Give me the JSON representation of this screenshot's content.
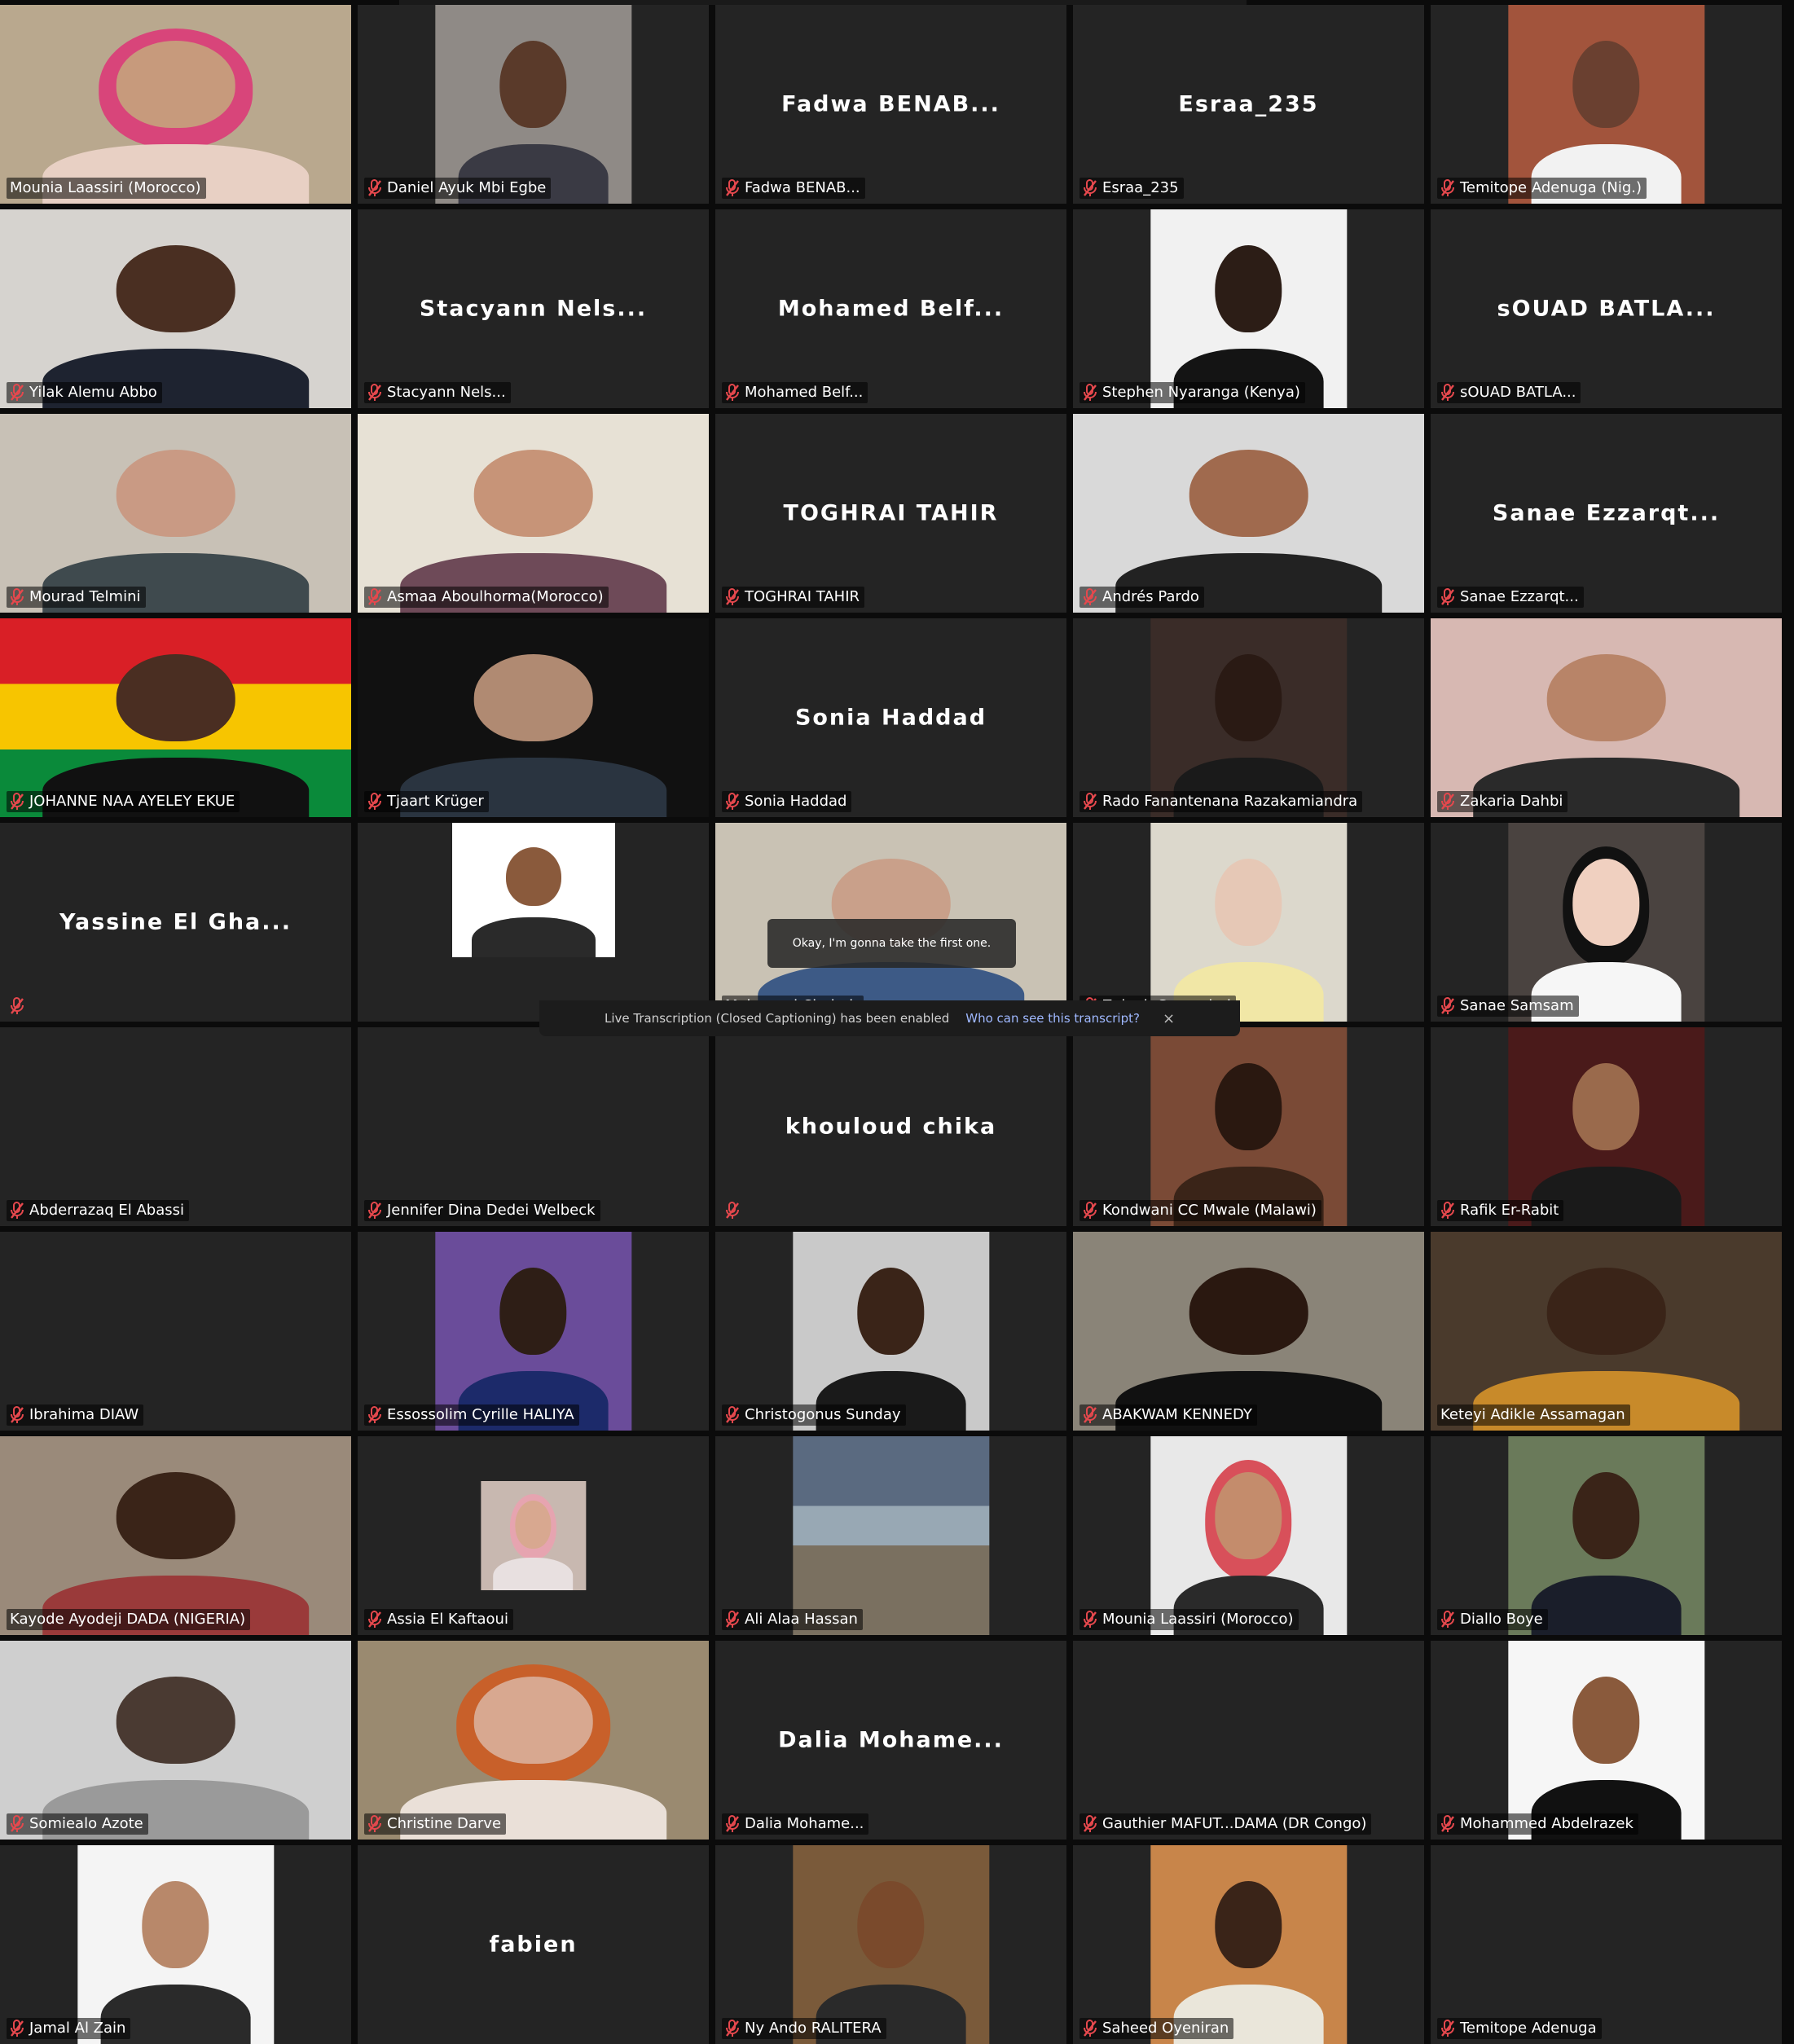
{
  "caption": "Okay, I'm gonna take the first one.",
  "notice": {
    "text": "Live Transcription (Closed Captioning) has been enabled",
    "link": "Who can see this transcript?",
    "close": "×"
  },
  "colors": {
    "tile": "#242424",
    "active_border": "#2bd46a",
    "muted_mic": "#e5484d",
    "background": "#0b0b0b"
  },
  "participants": [
    {
      "name": "Mounia Laassiri (Morocco)",
      "muted": false,
      "video": true,
      "bg": "#b9a88e",
      "skin": "#c79a7c",
      "shirt": "#e8d0c4",
      "hair": "#d8457a"
    },
    {
      "name": "Daniel Ayuk Mbi Egbe",
      "muted": true,
      "video": true,
      "narrow": true,
      "bg": "#8f8a86",
      "skin": "#5a3a2a",
      "shirt": "#3a3a44"
    },
    {
      "name": "Fadwa BENAB...",
      "muted": true,
      "video": false,
      "title": "Fadwa BENAB..."
    },
    {
      "name": "Esraa_235",
      "muted": true,
      "video": false,
      "title": "Esraa_235"
    },
    {
      "name": "Temitope Adenuga (Nig.)",
      "muted": true,
      "video": true,
      "narrow": true,
      "bg": "#a2543c",
      "skin": "#6a4030",
      "shirt": "#f2f2f2"
    },
    {
      "name": "Yilak Alemu Abbo",
      "muted": true,
      "video": true,
      "bg": "#d6d3cf",
      "skin": "#4a2f22",
      "shirt": "#1e2330"
    },
    {
      "name": "Stacyann Nels...",
      "muted": true,
      "video": false,
      "title": "Stacyann Nels..."
    },
    {
      "name": "Mohamed Belf...",
      "muted": true,
      "video": false,
      "title": "Mohamed Belf..."
    },
    {
      "name": "Stephen Nyaranga (Kenya)",
      "muted": true,
      "video": true,
      "narrow": true,
      "bg": "#f1f1f1",
      "skin": "#2c1d16",
      "shirt": "#141414"
    },
    {
      "name": "sOUAD BATLA...",
      "muted": true,
      "video": false,
      "title": "sOUAD BATLA..."
    },
    {
      "name": "Mourad Telmini",
      "muted": true,
      "video": true,
      "bg": "#c8c1b6",
      "skin": "#c99a84",
      "shirt": "#3f4a4e"
    },
    {
      "name": "Asmaa Aboulhorma(Morocco)",
      "muted": true,
      "video": true,
      "bg": "#e7e1d5",
      "skin": "#c79478",
      "shirt": "#6e4a58"
    },
    {
      "name": "TOGHRAI TAHIR",
      "muted": true,
      "video": false,
      "title": "TOGHRAI TAHIR"
    },
    {
      "name": "Andrés Pardo",
      "muted": true,
      "video": true,
      "bg": "#d9d9d9",
      "skin": "#a06a4e",
      "shirt": "#222222"
    },
    {
      "name": "Sanae Ezzarqt...",
      "muted": true,
      "video": false,
      "title": "Sanae Ezzarqt..."
    },
    {
      "name": "JOHANNE NAA AYELEY EKUE",
      "muted": true,
      "video": true,
      "flag": true,
      "skin": "#4a2e22",
      "shirt": "#111111"
    },
    {
      "name": "Tjaart Krüger",
      "muted": true,
      "video": true,
      "bg": "#111111",
      "skin": "#b08a72",
      "shirt": "#2a3440"
    },
    {
      "name": "Sonia Haddad",
      "muted": true,
      "video": false,
      "title": "Sonia Haddad"
    },
    {
      "name": "Rado Fanantenana Razakamiandra",
      "muted": true,
      "video": true,
      "narrow": true,
      "bg": "#3a2c28",
      "skin": "#2a1a14",
      "shirt": "#1a1a1a"
    },
    {
      "name": "Zakaria Dahbi",
      "muted": true,
      "video": true,
      "bg": "#d7b8b2",
      "skin": "#b88468",
      "shirt": "#2a2a2a"
    },
    {
      "name": "Yassine El Gha...",
      "muted": true,
      "video": false,
      "title": "Yassine El Gha...",
      "nolabel": true
    },
    {
      "name": "",
      "muted": false,
      "video": true,
      "bust": true,
      "bg": "#ffffff",
      "skin": "#8a5a3c",
      "shirt": "#2a2a2a"
    },
    {
      "name": "Mohamed Chabab",
      "muted": false,
      "video": true,
      "bg": "#c9c2b4",
      "skin": "#c9a08a",
      "shirt": "#3d5a86"
    },
    {
      "name": "Zainab Soumaimi",
      "muted": true,
      "video": true,
      "narrow": true,
      "bg": "#dcd8cc",
      "skin": "#e6c8b6",
      "shirt": "#f1e7a6"
    },
    {
      "name": "Sanae Samsam",
      "muted": true,
      "video": true,
      "narrow": true,
      "bg": "#4a4340",
      "skin": "#f0d0c0",
      "shirt": "#f6f6f6",
      "hair": "#111111"
    },
    {
      "name": "Abderrazaq El Abassi",
      "muted": true,
      "video": false,
      "title": ""
    },
    {
      "name": "Jennifer Dina Dedei Welbeck",
      "muted": true,
      "video": false,
      "title": ""
    },
    {
      "name": "",
      "muted": true,
      "video": false,
      "title": "khouloud chika"
    },
    {
      "name": "Kondwani CC Mwale (Malawi)",
      "muted": true,
      "video": true,
      "narrow": true,
      "bg": "#7a4a36",
      "skin": "#2a1810",
      "shirt": "#3a2418"
    },
    {
      "name": "Rafik Er-Rabit",
      "muted": true,
      "video": true,
      "narrow": true,
      "bg": "#4a1a1a",
      "skin": "#9a6a4c",
      "shirt": "#1a1a1a"
    },
    {
      "name": "Ibrahima DIAW",
      "muted": true,
      "video": false,
      "title": ""
    },
    {
      "name": "Essossolim Cyrille HALIYA",
      "muted": true,
      "video": true,
      "narrow": true,
      "bg": "#6a4c9a",
      "skin": "#2e1e16",
      "shirt": "#1c2a6a"
    },
    {
      "name": "Christogonus Sunday",
      "muted": true,
      "video": true,
      "tiny": false,
      "narrow": true,
      "bg": "#c9c9c9",
      "skin": "#3a2418",
      "shirt": "#1a1a1a"
    },
    {
      "name": "ABAKWAM KENNEDY",
      "muted": true,
      "video": true,
      "bg": "#8a8478",
      "skin": "#2a1810",
      "shirt": "#111111"
    },
    {
      "name": "Keteyi Adikle Assamagan",
      "muted": false,
      "video": true,
      "active": true,
      "bg": "#4a3a2c",
      "skin": "#3a2418",
      "shirt": "#c88a2a"
    },
    {
      "name": "Kayode Ayodeji DADA (NIGERIA)",
      "muted": false,
      "video": true,
      "bg": "#9a8a7a",
      "skin": "#3a2418",
      "shirt": "#9a3a3a"
    },
    {
      "name": "Assia El Kaftaoui",
      "muted": true,
      "video": true,
      "tiny": true,
      "bg": "#c8b8b0",
      "skin": "#d8a890",
      "shirt": "#e8e0e0",
      "hair": "#e6a4b0"
    },
    {
      "name": "Ali Alaa Hassan",
      "muted": true,
      "video": true,
      "narrow": true,
      "scene": true,
      "bg": "#6a7a8a",
      "skin": "#8a8a8a",
      "shirt": "#4a5a6a"
    },
    {
      "name": "Mounia Laassiri (Morocco)",
      "muted": true,
      "video": true,
      "narrow": true,
      "bg": "#e8e8e8",
      "skin": "#c48c6c",
      "shirt": "#2a2a2a",
      "hair": "#d8505a"
    },
    {
      "name": "Diallo Boye",
      "muted": true,
      "video": true,
      "narrow": true,
      "bg": "#6a7a5a",
      "skin": "#3a2418",
      "shirt": "#1a1e2a"
    },
    {
      "name": "Somiealo Azote",
      "muted": true,
      "video": true,
      "bg": "#cfcfcf",
      "skin": "#4a3a32",
      "shirt": "#9a9a9a"
    },
    {
      "name": "Christine Darve",
      "muted": true,
      "video": true,
      "bg": "#9a8a70",
      "skin": "#d8a890",
      "shirt": "#eae0d8",
      "hair": "#c8602a"
    },
    {
      "name": "Dalia Mohame...",
      "muted": true,
      "video": false,
      "title": "Dalia Mohame..."
    },
    {
      "name": "Gauthier MAFUT...DAMA (DR Congo)",
      "muted": true,
      "video": false,
      "title": ""
    },
    {
      "name": "Mohammed Abdelrazek",
      "muted": true,
      "video": true,
      "narrow": true,
      "bg": "#f6f6f6",
      "skin": "#8a5a3c",
      "shirt": "#111111"
    },
    {
      "name": "Jamal Al Zain",
      "muted": true,
      "video": true,
      "narrow": true,
      "bg": "#f4f4f4",
      "skin": "#b8886a",
      "shirt": "#2a2a2a"
    },
    {
      "name": "",
      "muted": false,
      "video": false,
      "title": "fabien",
      "nolabel": true
    },
    {
      "name": "Ny Ando RALITERA",
      "muted": true,
      "video": true,
      "narrow": true,
      "bg": "#7a5a3a",
      "skin": "#7a4a2c",
      "shirt": "#2a2a2a"
    },
    {
      "name": "Saheed Oyeniran",
      "muted": true,
      "video": true,
      "narrow": true,
      "bg": "#c8854a",
      "skin": "#3a2418",
      "shirt": "#eae6da"
    },
    {
      "name": "Temitope Adenuga",
      "muted": true,
      "video": false,
      "title": ""
    }
  ]
}
